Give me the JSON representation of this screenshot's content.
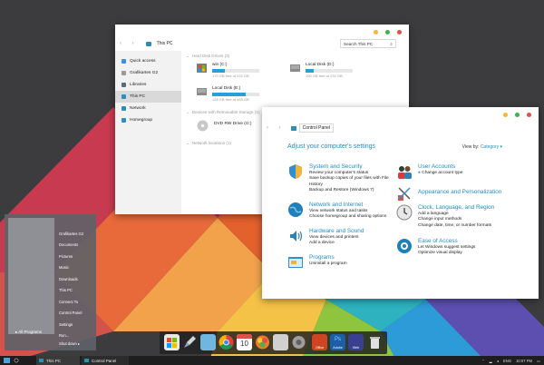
{
  "explorer": {
    "title": "This PC",
    "search_placeholder": "Search This PC",
    "nav_arrows": "‹ ›",
    "sidebar": [
      {
        "label": "Quick access",
        "icon": "star-icon",
        "color": "#3a8ee6"
      },
      {
        "label": "Grafikartes G2",
        "icon": "user-folder-icon",
        "color": "#9a9a9a"
      },
      {
        "label": "Libraries",
        "icon": "library-icon",
        "color": "#5b6b7b"
      },
      {
        "label": "This PC",
        "icon": "computer-icon",
        "color": "#2c8fb5"
      },
      {
        "label": "Network",
        "icon": "network-icon",
        "color": "#2c8fb5"
      },
      {
        "label": "Homegroup",
        "icon": "homegroup-icon",
        "color": "#2c8fb5"
      }
    ],
    "group_hard_disks": "Hard Disk Drives (3)",
    "group_removable": "Devices with Removable Storage (1)",
    "group_network": "Network locations (1)",
    "drives": [
      {
        "name": "win (C:)",
        "free": "170 GB free of 232 GB",
        "used_fraction": 0.27
      },
      {
        "name": "Local Disk (D:)",
        "free": "190 GB free of 232 GB",
        "used_fraction": 0.18
      },
      {
        "name": "Local Disk (E:)",
        "free": "128 GB free of 465 GB",
        "used_fraction": 0.72
      },
      {
        "name": "DVD RW Drive (G:)",
        "free": ""
      }
    ]
  },
  "control_panel": {
    "crumb": "Control Panel",
    "heading": "Adjust your computer's settings",
    "view_by_label": "View by:",
    "view_by_value": "Category ▾",
    "categories_left": [
      {
        "title": "System and Security",
        "links": [
          "Review your computer's status",
          "Save backup copies of your files with File History",
          "Backup and Restore (Windows 7)"
        ],
        "icon": "shield-icon"
      },
      {
        "title": "Network and Internet",
        "links": [
          "View network status and tasks",
          "Choose homegroup and sharing options"
        ],
        "icon": "globe-icon"
      },
      {
        "title": "Hardware and Sound",
        "links": [
          "View devices and printers",
          "Add a device"
        ],
        "icon": "speaker-icon"
      },
      {
        "title": "Programs",
        "links": [
          "Uninstall a program"
        ],
        "icon": "programs-icon"
      }
    ],
    "categories_right": [
      {
        "title": "User Accounts",
        "links": [
          "Change account type"
        ],
        "icon": "users-icon"
      },
      {
        "title": "Appearance and Personalization",
        "links": [],
        "icon": "personalization-icon"
      },
      {
        "title": "Clock, Language, and Region",
        "links": [
          "Add a language",
          "Change input methods",
          "Change date, time, or number formats"
        ],
        "icon": "clock-icon"
      },
      {
        "title": "Ease of Access",
        "links": [
          "Let Windows suggest settings",
          "Optimize visual display"
        ],
        "icon": "ease-icon"
      }
    ]
  },
  "start_menu": {
    "all_programs": "All Programs",
    "items": [
      "Grafikartes G2",
      "Documents",
      "Pictures",
      "Music",
      "Downloads",
      "This PC",
      "Connect To",
      "Control Panel",
      "Settings",
      "Run..."
    ],
    "shutdown": "Shut down"
  },
  "dock": {
    "items": [
      {
        "icon": "start-tiles-icon",
        "label": "",
        "color": "#e44d2e"
      },
      {
        "icon": "rocket-icon",
        "label": "",
        "color": "#cfd8dc"
      },
      {
        "icon": "tag-icon",
        "label": "",
        "color": "#6fb7e0"
      },
      {
        "icon": "chrome-icon",
        "label": "",
        "color": "#f2b400"
      },
      {
        "icon": "calendar-icon",
        "label": "",
        "color": "#ffffff"
      },
      {
        "icon": "photos-icon",
        "label": "",
        "color": "#f47b20"
      },
      {
        "icon": "contacts-icon",
        "label": "",
        "color": "#d0d0d0"
      },
      {
        "icon": "settings-gear-icon",
        "label": "",
        "color": "#9e9e9e"
      },
      {
        "icon": "office-icon",
        "label": "Office",
        "color": "#d04423"
      },
      {
        "icon": "photoshop-icon",
        "label": "Adobe",
        "color": "#1b5fa8"
      },
      {
        "icon": "web-icon",
        "label": "Web",
        "color": "#3a3f8f"
      },
      {
        "icon": "recycle-bin-icon",
        "label": "",
        "color": "#e0e0e0"
      }
    ]
  },
  "taskbar": {
    "tasks": [
      "This PC",
      "Control Panel"
    ],
    "tray_lang": "ENG",
    "tray_time": "10:07 PM"
  },
  "colors": {
    "accent": "#1f8dc4",
    "close": "#e2504a",
    "max": "#3bb54a",
    "min": "#f5b82e"
  }
}
